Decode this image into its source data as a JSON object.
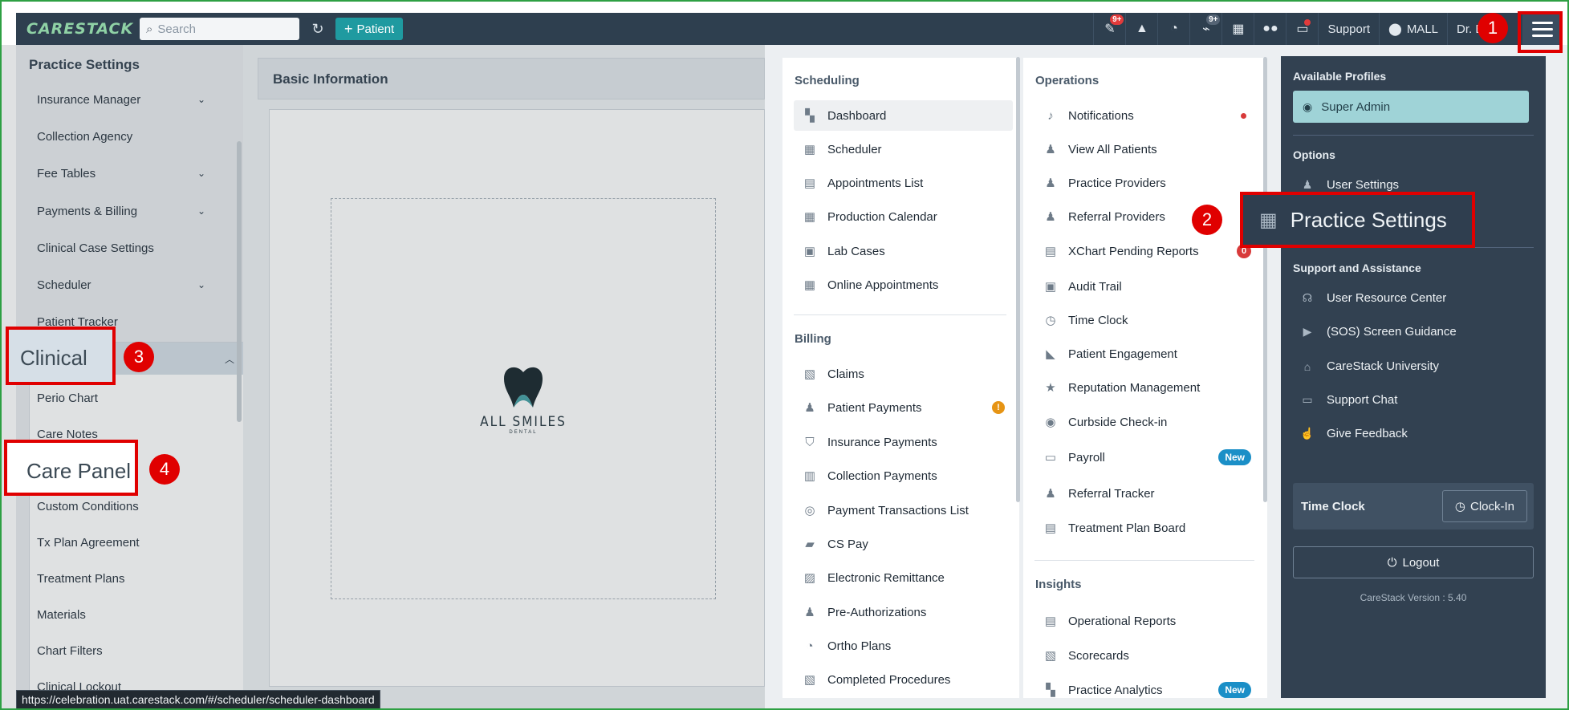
{
  "topbar": {
    "logo": "CARESTACK",
    "search_placeholder": "Search",
    "patient_button": "Patient",
    "badges": {
      "tasks": "9+",
      "wifi": "9+"
    },
    "support": "Support",
    "location": "MALL",
    "user": "Dr. ES"
  },
  "sidebar": {
    "title": "Practice Settings",
    "items": [
      "Insurance Manager",
      "Collection Agency",
      "Fee Tables",
      "Payments & Billing",
      "Clinical Case Settings",
      "Scheduler",
      "Patient Tracker"
    ],
    "clinical_group": "Clinical",
    "clinical_items": [
      "Perio Chart",
      "Care Notes",
      "Care Panel",
      "Custom Conditions",
      "Tx Plan Agreement",
      "Treatment Plans",
      "Materials",
      "Chart Filters",
      "Clinical Lockout"
    ]
  },
  "main": {
    "section_title": "Basic Information",
    "logo_brand": "ALL SMILES",
    "logo_sub": "DENTAL"
  },
  "menu": {
    "scheduling": {
      "title": "Scheduling",
      "items": [
        "Dashboard",
        "Scheduler",
        "Appointments List",
        "Production Calendar",
        "Lab Cases",
        "Online Appointments"
      ]
    },
    "billing": {
      "title": "Billing",
      "items": [
        "Claims",
        "Patient Payments",
        "Insurance Payments",
        "Collection Payments",
        "Payment Transactions List",
        "CS Pay",
        "Electronic Remittance",
        "Pre-Authorizations",
        "Ortho Plans",
        "Completed Procedures"
      ]
    },
    "operations": {
      "title": "Operations",
      "items": [
        "Notifications",
        "View All Patients",
        "Practice Providers",
        "Referral Providers",
        "XChart Pending Reports",
        "Audit Trail",
        "Time Clock",
        "Patient Engagement",
        "Reputation Management",
        "Curbside Check-in",
        "Payroll",
        "Referral Tracker",
        "Treatment Plan Board"
      ]
    },
    "insights": {
      "title": "Insights",
      "items": [
        "Operational Reports",
        "Scorecards",
        "Practice Analytics"
      ]
    },
    "badges": {
      "xchart_count": "0",
      "new": "New",
      "warn": "!"
    }
  },
  "profile": {
    "available_profiles": "Available Profiles",
    "profile_name": "Super Admin",
    "options_title": "Options",
    "user_settings": "User Settings",
    "practice_settings": "Practice Settings",
    "support_title": "Support and Assistance",
    "support_items": [
      "User Resource Center",
      "(SOS) Screen Guidance",
      "CareStack University",
      "Support Chat",
      "Give Feedback"
    ],
    "time_clock": "Time Clock",
    "clock_in": "Clock-In",
    "logout": "Logout",
    "version": "CareStack Version : 5.40"
  },
  "annotations": {
    "n1": "1",
    "n2": "2",
    "n3": "3",
    "n4": "4",
    "label2": "Practice Settings",
    "label3": "Clinical",
    "label4": "Care Panel"
  },
  "status_url": "https://celebration.uat.carestack.com/#/scheduler/scheduler-dashboard"
}
